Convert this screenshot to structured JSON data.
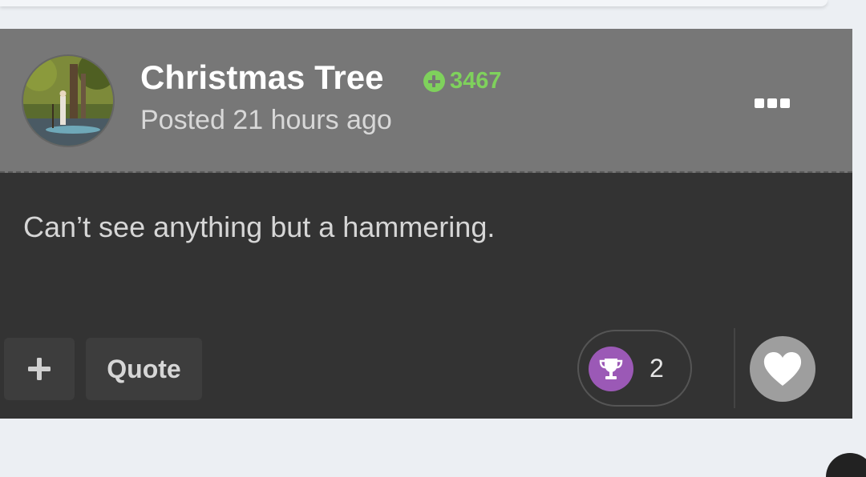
{
  "post": {
    "author": {
      "name": "Christmas Tree",
      "reputation": "3467",
      "reputation_icon": "plus-circle-icon",
      "avatar_icon": "avatar-photo"
    },
    "posted_label": "Posted 21 hours ago",
    "more_icon": "ellipsis-icon",
    "body": "Can’t see anything but a hammering."
  },
  "actions": {
    "add_icon": "plus-icon",
    "quote_label": "Quote",
    "reaction": {
      "icon": "trophy-icon",
      "count": "2"
    },
    "like_icon": "heart-icon"
  },
  "colors": {
    "header_bg": "#777777",
    "body_bg": "#333333",
    "reputation": "#7fd15c",
    "trophy_badge": "#9b59b6",
    "page_bg": "#eceff3"
  }
}
